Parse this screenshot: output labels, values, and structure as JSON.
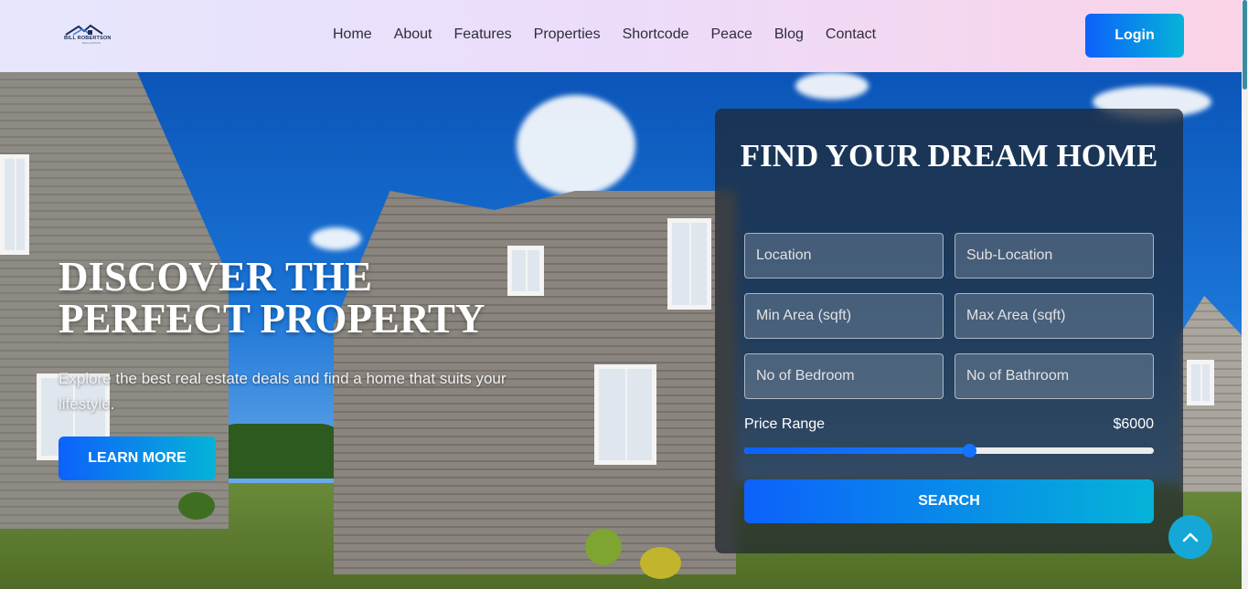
{
  "header": {
    "logo_text": "BILL ROBERTSON",
    "logo_sub": "REAL ESTATE",
    "nav": [
      "Home",
      "About",
      "Features",
      "Properties",
      "Shortcode",
      "Peace",
      "Blog",
      "Contact"
    ],
    "login_label": "Login"
  },
  "hero": {
    "title": "DISCOVER THE PERFECT PROPERTY",
    "subtitle": "Explore the best real estate deals and find a home that suits your lifestyle.",
    "cta_label": "LEARN MORE"
  },
  "search": {
    "title": "FIND YOUR DREAM HOME",
    "fields": {
      "location": "Location",
      "sub_location": "Sub-Location",
      "min_area": "Min Area (sqft)",
      "max_area": "Max Area (sqft)",
      "bedrooms": "No of Bedroom",
      "bathrooms": "No of Bathroom"
    },
    "price_label": "Price Range",
    "price_value": "$6000",
    "price_fraction": 0.55,
    "button_label": "SEARCH"
  },
  "colors": {
    "accent_start": "#0d61fb",
    "accent_end": "#05b3d8",
    "to_top": "#15a8d6"
  },
  "icons": {
    "logo": "house-roof-icon",
    "to_top": "chevron-up-icon"
  }
}
